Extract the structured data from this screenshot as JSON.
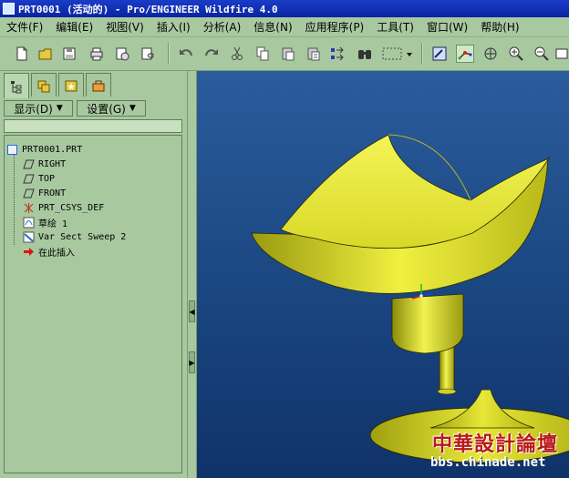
{
  "window": {
    "title": "PRT0001 (活动的) - Pro/ENGINEER Wildfire 4.0"
  },
  "menu": [
    "文件(F)",
    "编辑(E)",
    "视图(V)",
    "插入(I)",
    "分析(A)",
    "信息(N)",
    "应用程序(P)",
    "工具(T)",
    "窗口(W)",
    "帮助(H)"
  ],
  "panel": {
    "display_label": "显示(D)",
    "settings_label": "设置(G)",
    "tree": [
      {
        "label": "PRT0001.PRT",
        "icon": "part-icon"
      },
      {
        "label": "RIGHT",
        "icon": "datum-plane-icon"
      },
      {
        "label": "TOP",
        "icon": "datum-plane-icon"
      },
      {
        "label": "FRONT",
        "icon": "datum-plane-icon"
      },
      {
        "label": "PRT_CSYS_DEF",
        "icon": "csys-icon"
      },
      {
        "label": "草绘 1",
        "icon": "sketch-icon"
      },
      {
        "label": "Var Sect Sweep 2",
        "icon": "sweep-icon"
      },
      {
        "label": "在此插入",
        "icon": "insert-here-arrow-icon"
      }
    ]
  },
  "watermark": {
    "title": "中華設計論壇",
    "url": "bbs.chinade.net"
  },
  "colors": {
    "ui_green": "#a8c8a0",
    "model_yellow": "#e8e840",
    "title_blue": "#0a24a0"
  }
}
